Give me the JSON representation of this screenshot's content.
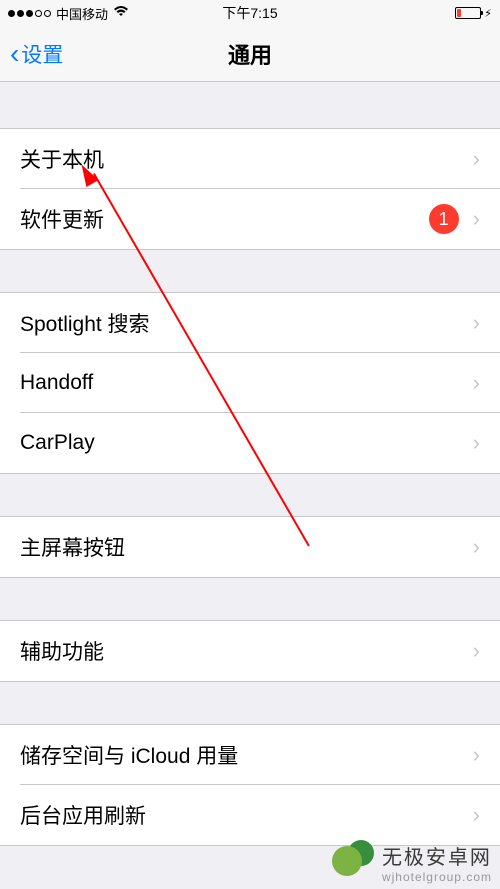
{
  "status": {
    "carrier": "中国移动",
    "time": "下午7:15"
  },
  "nav": {
    "back_label": "设置",
    "title": "通用"
  },
  "groups": [
    {
      "items": [
        {
          "label": "关于本机",
          "name": "about-item"
        },
        {
          "label": "软件更新",
          "name": "software-update-item",
          "badge": "1"
        }
      ]
    },
    {
      "items": [
        {
          "label": "Spotlight 搜索",
          "name": "spotlight-item"
        },
        {
          "label": "Handoff",
          "name": "handoff-item"
        },
        {
          "label": "CarPlay",
          "name": "carplay-item"
        }
      ]
    },
    {
      "items": [
        {
          "label": "主屏幕按钮",
          "name": "home-button-item"
        }
      ]
    },
    {
      "items": [
        {
          "label": "辅助功能",
          "name": "accessibility-item"
        }
      ]
    },
    {
      "items": [
        {
          "label": "储存空间与 iCloud 用量",
          "name": "storage-item"
        },
        {
          "label": "后台应用刷新",
          "name": "background-refresh-item"
        }
      ]
    }
  ],
  "watermark": {
    "name": "无极安卓网",
    "domain": "wjhotelgroup.com"
  }
}
